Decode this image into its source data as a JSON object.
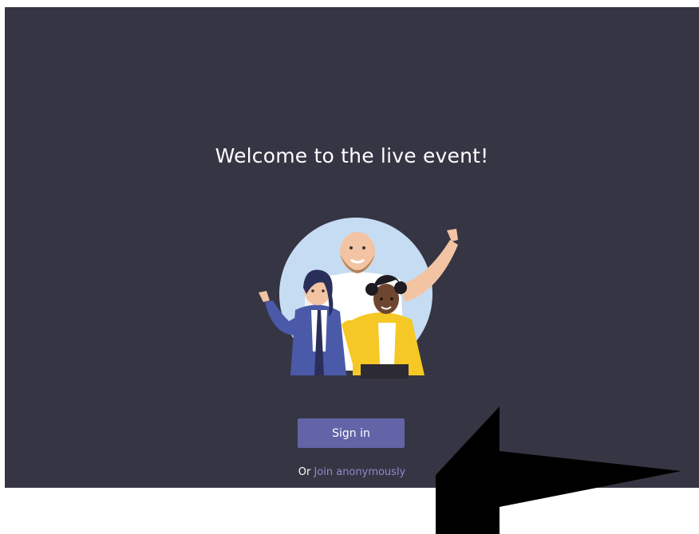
{
  "page": {
    "welcome_text": "Welcome to the live event!",
    "signin_label": "Sign in",
    "or_prefix": "Or",
    "join_label": "Join anonymously"
  },
  "icons": {
    "illustration": "people-waving-illustration",
    "annotation": "arrow-pointer-icon"
  },
  "colors": {
    "background": "#363543",
    "accent": "#6264a7",
    "link": "#8a8cd0",
    "arrow": "#000000"
  }
}
